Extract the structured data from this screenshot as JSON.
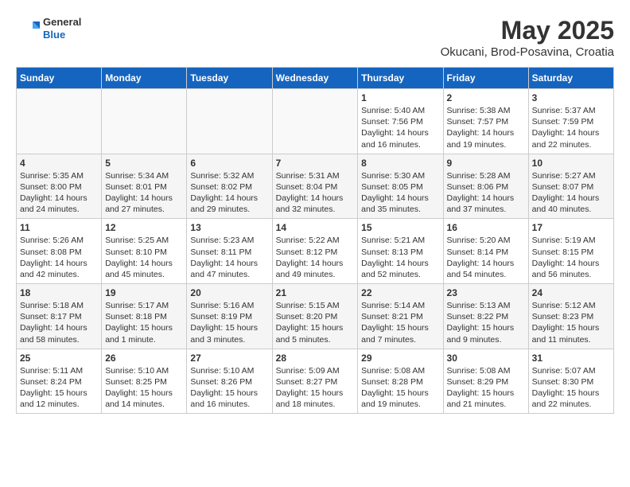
{
  "header": {
    "logo_general": "General",
    "logo_blue": "Blue",
    "title": "May 2025",
    "subtitle": "Okucani, Brod-Posavina, Croatia"
  },
  "calendar": {
    "days_of_week": [
      "Sunday",
      "Monday",
      "Tuesday",
      "Wednesday",
      "Thursday",
      "Friday",
      "Saturday"
    ],
    "weeks": [
      [
        {
          "day": "",
          "info": ""
        },
        {
          "day": "",
          "info": ""
        },
        {
          "day": "",
          "info": ""
        },
        {
          "day": "",
          "info": ""
        },
        {
          "day": "1",
          "info": "Sunrise: 5:40 AM\nSunset: 7:56 PM\nDaylight: 14 hours\nand 16 minutes."
        },
        {
          "day": "2",
          "info": "Sunrise: 5:38 AM\nSunset: 7:57 PM\nDaylight: 14 hours\nand 19 minutes."
        },
        {
          "day": "3",
          "info": "Sunrise: 5:37 AM\nSunset: 7:59 PM\nDaylight: 14 hours\nand 22 minutes."
        }
      ],
      [
        {
          "day": "4",
          "info": "Sunrise: 5:35 AM\nSunset: 8:00 PM\nDaylight: 14 hours\nand 24 minutes."
        },
        {
          "day": "5",
          "info": "Sunrise: 5:34 AM\nSunset: 8:01 PM\nDaylight: 14 hours\nand 27 minutes."
        },
        {
          "day": "6",
          "info": "Sunrise: 5:32 AM\nSunset: 8:02 PM\nDaylight: 14 hours\nand 29 minutes."
        },
        {
          "day": "7",
          "info": "Sunrise: 5:31 AM\nSunset: 8:04 PM\nDaylight: 14 hours\nand 32 minutes."
        },
        {
          "day": "8",
          "info": "Sunrise: 5:30 AM\nSunset: 8:05 PM\nDaylight: 14 hours\nand 35 minutes."
        },
        {
          "day": "9",
          "info": "Sunrise: 5:28 AM\nSunset: 8:06 PM\nDaylight: 14 hours\nand 37 minutes."
        },
        {
          "day": "10",
          "info": "Sunrise: 5:27 AM\nSunset: 8:07 PM\nDaylight: 14 hours\nand 40 minutes."
        }
      ],
      [
        {
          "day": "11",
          "info": "Sunrise: 5:26 AM\nSunset: 8:08 PM\nDaylight: 14 hours\nand 42 minutes."
        },
        {
          "day": "12",
          "info": "Sunrise: 5:25 AM\nSunset: 8:10 PM\nDaylight: 14 hours\nand 45 minutes."
        },
        {
          "day": "13",
          "info": "Sunrise: 5:23 AM\nSunset: 8:11 PM\nDaylight: 14 hours\nand 47 minutes."
        },
        {
          "day": "14",
          "info": "Sunrise: 5:22 AM\nSunset: 8:12 PM\nDaylight: 14 hours\nand 49 minutes."
        },
        {
          "day": "15",
          "info": "Sunrise: 5:21 AM\nSunset: 8:13 PM\nDaylight: 14 hours\nand 52 minutes."
        },
        {
          "day": "16",
          "info": "Sunrise: 5:20 AM\nSunset: 8:14 PM\nDaylight: 14 hours\nand 54 minutes."
        },
        {
          "day": "17",
          "info": "Sunrise: 5:19 AM\nSunset: 8:15 PM\nDaylight: 14 hours\nand 56 minutes."
        }
      ],
      [
        {
          "day": "18",
          "info": "Sunrise: 5:18 AM\nSunset: 8:17 PM\nDaylight: 14 hours\nand 58 minutes."
        },
        {
          "day": "19",
          "info": "Sunrise: 5:17 AM\nSunset: 8:18 PM\nDaylight: 15 hours\nand 1 minute."
        },
        {
          "day": "20",
          "info": "Sunrise: 5:16 AM\nSunset: 8:19 PM\nDaylight: 15 hours\nand 3 minutes."
        },
        {
          "day": "21",
          "info": "Sunrise: 5:15 AM\nSunset: 8:20 PM\nDaylight: 15 hours\nand 5 minutes."
        },
        {
          "day": "22",
          "info": "Sunrise: 5:14 AM\nSunset: 8:21 PM\nDaylight: 15 hours\nand 7 minutes."
        },
        {
          "day": "23",
          "info": "Sunrise: 5:13 AM\nSunset: 8:22 PM\nDaylight: 15 hours\nand 9 minutes."
        },
        {
          "day": "24",
          "info": "Sunrise: 5:12 AM\nSunset: 8:23 PM\nDaylight: 15 hours\nand 11 minutes."
        }
      ],
      [
        {
          "day": "25",
          "info": "Sunrise: 5:11 AM\nSunset: 8:24 PM\nDaylight: 15 hours\nand 12 minutes."
        },
        {
          "day": "26",
          "info": "Sunrise: 5:10 AM\nSunset: 8:25 PM\nDaylight: 15 hours\nand 14 minutes."
        },
        {
          "day": "27",
          "info": "Sunrise: 5:10 AM\nSunset: 8:26 PM\nDaylight: 15 hours\nand 16 minutes."
        },
        {
          "day": "28",
          "info": "Sunrise: 5:09 AM\nSunset: 8:27 PM\nDaylight: 15 hours\nand 18 minutes."
        },
        {
          "day": "29",
          "info": "Sunrise: 5:08 AM\nSunset: 8:28 PM\nDaylight: 15 hours\nand 19 minutes."
        },
        {
          "day": "30",
          "info": "Sunrise: 5:08 AM\nSunset: 8:29 PM\nDaylight: 15 hours\nand 21 minutes."
        },
        {
          "day": "31",
          "info": "Sunrise: 5:07 AM\nSunset: 8:30 PM\nDaylight: 15 hours\nand 22 minutes."
        }
      ]
    ]
  }
}
